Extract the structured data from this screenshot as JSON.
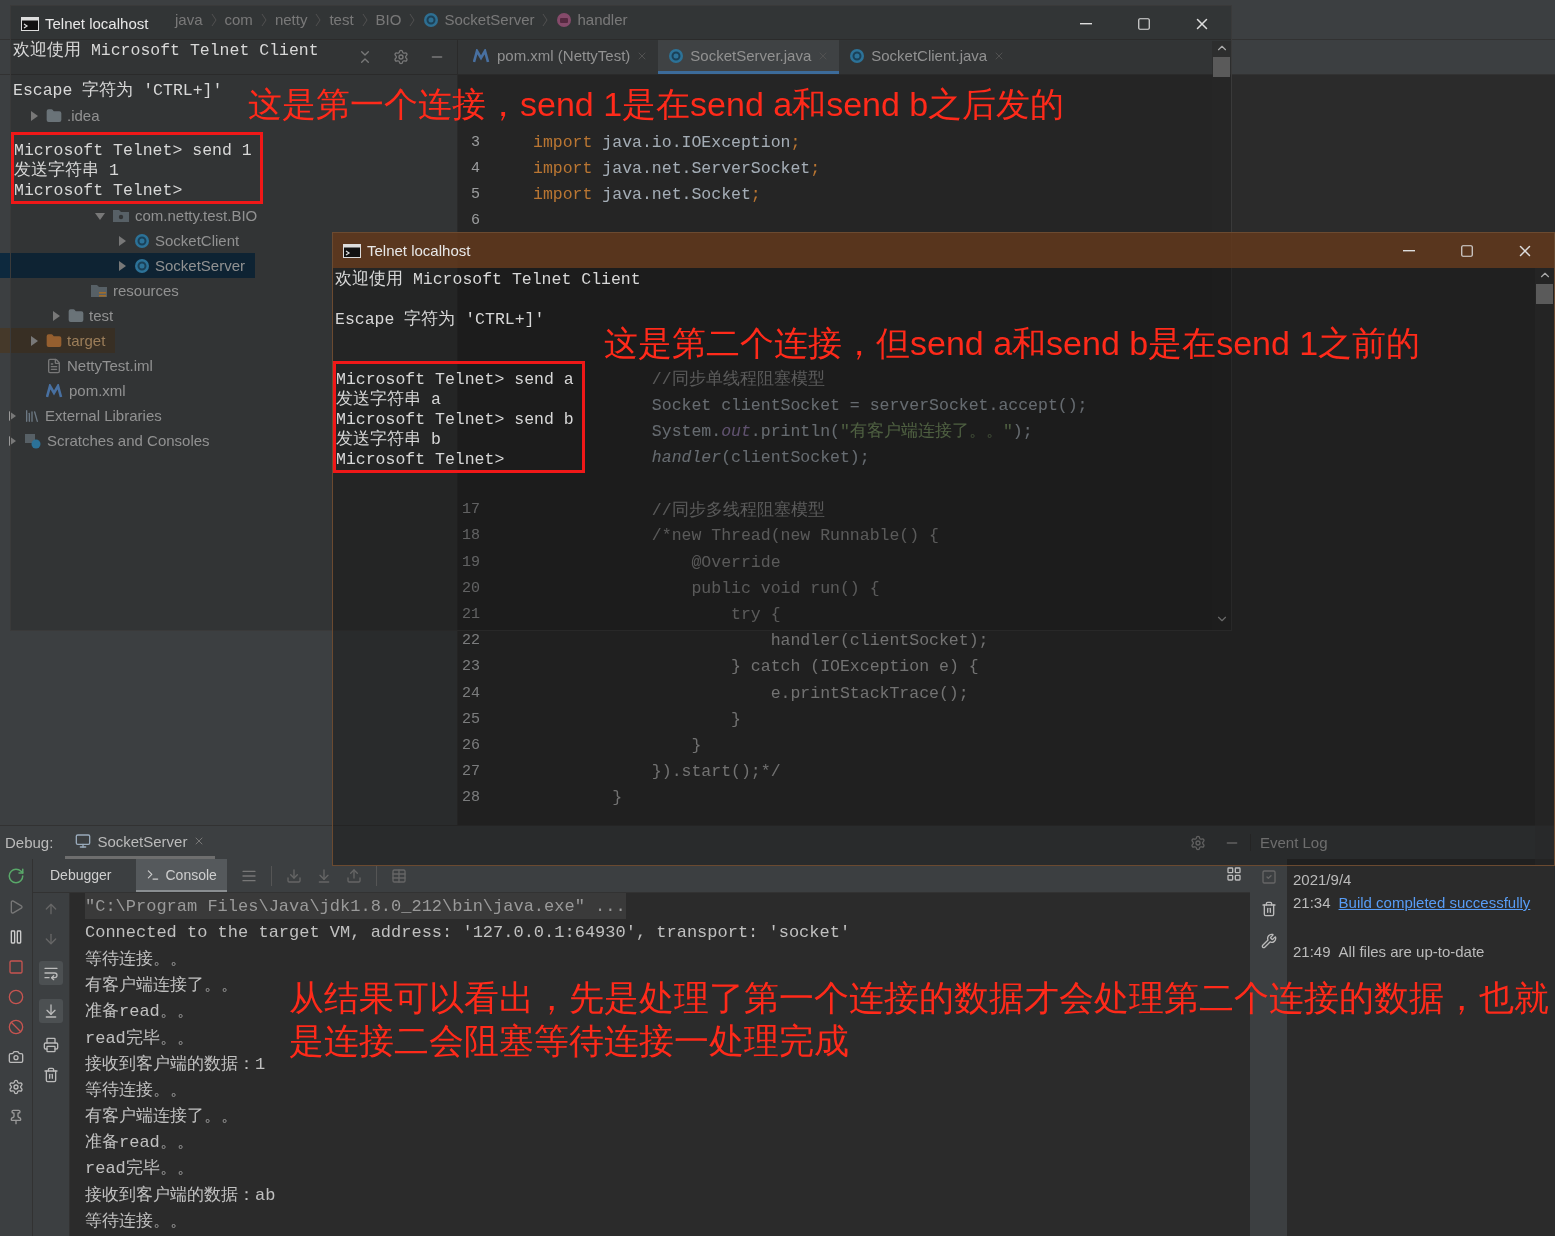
{
  "breadcrumb": [
    {
      "label": "java",
      "kind": "folder"
    },
    {
      "label": "com",
      "kind": "folder"
    },
    {
      "label": "netty",
      "kind": "folder"
    },
    {
      "label": "test",
      "kind": "folder"
    },
    {
      "label": "BIO",
      "kind": "folder"
    },
    {
      "label": "SocketServer",
      "kind": "class"
    },
    {
      "label": "handler",
      "kind": "method"
    }
  ],
  "editor_tabs": [
    {
      "label": "pom.xml (NettyTest)",
      "kind": "maven",
      "selected": false
    },
    {
      "label": "SocketServer.java",
      "kind": "class",
      "selected": true
    },
    {
      "label": "SocketClient.java",
      "kind": "class",
      "selected": false
    }
  ],
  "project_tree": [
    {
      "label": ".idea",
      "kind": "folder",
      "expanded": false,
      "selected": false
    },
    {
      "label": "com.netty.test.BIO",
      "kind": "package",
      "expanded": true,
      "selected": false,
      "children": [
        {
          "label": "SocketClient",
          "kind": "class",
          "expanded": false,
          "selected": false
        },
        {
          "label": "SocketServer",
          "kind": "class",
          "expanded": false,
          "selected": true
        }
      ]
    },
    {
      "label": "resources",
      "kind": "resources",
      "selected": false
    },
    {
      "label": "test",
      "kind": "folder",
      "expanded": false,
      "selected": false
    },
    {
      "label": "target",
      "kind": "excluded",
      "expanded": false,
      "selected": false
    },
    {
      "label": "NettyTest.iml",
      "kind": "file",
      "selected": false
    },
    {
      "label": "pom.xml",
      "kind": "maven",
      "selected": false
    },
    {
      "label": "External Libraries",
      "kind": "library",
      "expanded": false,
      "selected": false
    },
    {
      "label": "Scratches and Consoles",
      "kind": "scratch",
      "expanded": false,
      "selected": false
    }
  ],
  "editor": {
    "blocks": [
      {
        "lines": [
          {
            "num": "3",
            "tokens": [
              {
                "kind": "keyword",
                "text": "import"
              },
              {
                "kind": "plain",
                "text": " java.io.IOException"
              },
              {
                "kind": "keyword",
                "text": ";"
              }
            ]
          },
          {
            "num": "4",
            "tokens": [
              {
                "kind": "keyword",
                "text": "import"
              },
              {
                "kind": "plain",
                "text": " java.net.ServerSocket"
              },
              {
                "kind": "keyword",
                "text": ";"
              }
            ]
          },
          {
            "num": "5",
            "tokens": [
              {
                "kind": "keyword",
                "text": "import"
              },
              {
                "kind": "plain",
                "text": " java.net.Socket"
              },
              {
                "kind": "keyword",
                "text": ";"
              }
            ]
          },
          {
            "num": "6"
          }
        ]
      },
      {
        "lines": [
          {
            "tokens": [
              {
                "kind": "comment",
                "text": "            //同步单线程阻塞模型"
              }
            ]
          },
          {
            "tokens": [
              {
                "kind": "plain",
                "text": "            Socket clientSocket = serverSocket.accept();"
              }
            ]
          },
          {
            "tokens": [
              {
                "kind": "plain",
                "text": "            System."
              },
              {
                "kind": "field",
                "text": "out"
              },
              {
                "kind": "plain",
                "text": ".println("
              },
              {
                "kind": "string",
                "text": "\"有客户端连接了。。\""
              },
              {
                "kind": "plain",
                "text": ");"
              }
            ]
          },
          {
            "tokens": [
              {
                "kind": "call",
                "text": "            handler"
              },
              {
                "kind": "plain",
                "text": "(clientSocket);"
              }
            ]
          }
        ]
      },
      {
        "lines": [
          {
            "num": "17",
            "tokens": [
              {
                "kind": "comment",
                "text": "            //同步多线程阻塞模型"
              }
            ]
          },
          {
            "num": "18",
            "tokens": [
              {
                "kind": "comment",
                "text": "            /*new Thread(new Runnable() {"
              }
            ]
          },
          {
            "num": "19",
            "tokens": [
              {
                "kind": "comment",
                "text": "                @Override"
              }
            ]
          },
          {
            "num": "20",
            "tokens": [
              {
                "kind": "comment",
                "text": "                public void run() {"
              }
            ]
          },
          {
            "num": "21",
            "tokens": [
              {
                "kind": "comment",
                "text": "                    try {"
              }
            ]
          },
          {
            "num": "22",
            "tokens": [
              {
                "kind": "comment",
                "text": "                        handler(clientSocket);"
              }
            ]
          },
          {
            "num": "23",
            "tokens": [
              {
                "kind": "comment",
                "text": "                    } catch (IOException e) {"
              }
            ]
          },
          {
            "num": "24",
            "tokens": [
              {
                "kind": "comment",
                "text": "                        e.printStackTrace();"
              }
            ]
          },
          {
            "num": "25",
            "tokens": [
              {
                "kind": "comment",
                "text": "                    }"
              }
            ]
          },
          {
            "num": "26",
            "tokens": [
              {
                "kind": "comment",
                "text": "                }"
              }
            ]
          },
          {
            "num": "27",
            "tokens": [
              {
                "kind": "comment",
                "text": "            }).start();*/"
              }
            ]
          },
          {
            "num": "28",
            "tokens": [
              {
                "kind": "comment",
                "text": "        }"
              }
            ]
          }
        ]
      }
    ]
  },
  "debug_panel": {
    "title": "Debug:",
    "session_tab": "SocketServer",
    "tabs": [
      {
        "label": "Debugger",
        "selected": false
      },
      {
        "label": "Console",
        "selected": true
      }
    ],
    "console_lines": [
      {
        "kind": "command",
        "text": "\"C:\\Program Files\\Java\\jdk1.8.0_212\\bin\\java.exe\" ..."
      },
      {
        "kind": "output",
        "text": "Connected to the target VM, address: '127.0.0.1:64930', transport: 'socket'"
      },
      {
        "kind": "output",
        "text": "等待连接。。"
      },
      {
        "kind": "output",
        "text": "有客户端连接了。。"
      },
      {
        "kind": "output",
        "text": "准备read。。"
      },
      {
        "kind": "output",
        "text": "read完毕。。"
      },
      {
        "kind": "output",
        "text": "接收到客户端的数据：1"
      },
      {
        "kind": "output",
        "text": "等待连接。。"
      },
      {
        "kind": "output",
        "text": "有客户端连接了。。"
      },
      {
        "kind": "output",
        "text": "准备read。。"
      },
      {
        "kind": "output",
        "text": "read完毕。。"
      },
      {
        "kind": "output",
        "text": "接收到客户端的数据：ab"
      },
      {
        "kind": "output",
        "text": "等待连接。。"
      }
    ]
  },
  "event_log": {
    "title": "Event Log",
    "date": "2021/9/4",
    "entries": [
      {
        "time": "21:34",
        "text": "Build completed successfully",
        "kind": "link"
      },
      {
        "time": "21:49",
        "text": "All files are up-to-date",
        "kind": "text"
      }
    ]
  },
  "telnet_windows": [
    {
      "title": "Telnet localhost",
      "blocks": [
        {
          "lines": [
            "欢迎使用 Microsoft Telnet Client"
          ],
          "highlighted": false
        },
        {
          "lines": [
            "Escape 字符为 'CTRL+]'"
          ],
          "highlighted": false
        },
        {
          "lines": [
            "Microsoft Telnet> send 1",
            "发送字符串 1",
            "Microsoft Telnet>"
          ],
          "highlighted": true
        }
      ]
    },
    {
      "title": "Telnet localhost",
      "blocks": [
        {
          "lines": [
            "欢迎使用 Microsoft Telnet Client"
          ],
          "highlighted": false
        },
        {
          "lines": [
            "Escape 字符为 'CTRL+]'"
          ],
          "highlighted": false
        },
        {
          "lines": [
            "Microsoft Telnet> send a",
            "发送字符串 a",
            "Microsoft Telnet> send b",
            "发送字符串 b",
            "Microsoft Telnet>"
          ],
          "highlighted": true
        }
      ]
    }
  ],
  "annotations": [
    {
      "text": "这是第一个连接，send 1是在send a和send b之后发的"
    },
    {
      "text": "这是第二个连接，但send a和send b是在send 1之前的"
    },
    {
      "text": "从结果可以看出，先是处理了第一个连接的数据才会处理第二个连接的数据，也就是连接二会阻塞等待连接一处理完成"
    }
  ]
}
